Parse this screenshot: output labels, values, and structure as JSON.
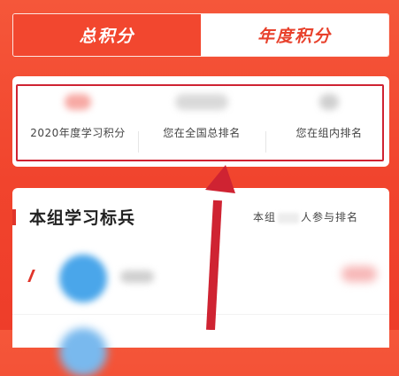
{
  "tabs": [
    {
      "label": "总积分",
      "active": true
    },
    {
      "label": "年度积分",
      "active": false
    }
  ],
  "stats": [
    {
      "label": "2020年度学习积分"
    },
    {
      "label": "您在全国总排名"
    },
    {
      "label": "您在组内排名"
    }
  ],
  "group": {
    "title": "本组学习标兵",
    "join_prefix": "本组",
    "join_suffix": "人参与排名"
  },
  "colors": {
    "accent_red": "#f1442d",
    "highlight_box": "#cf2332",
    "avatar_blue": "#4aa6ea"
  },
  "icons": {
    "annotation": "red-arrow-icon"
  }
}
